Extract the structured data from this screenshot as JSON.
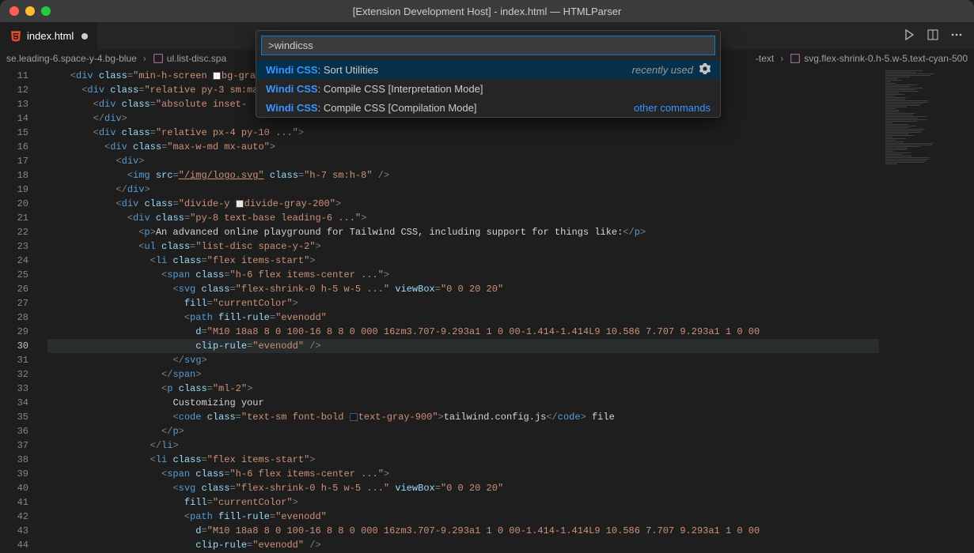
{
  "window": {
    "title": "[Extension Development Host] - index.html — HTMLParser"
  },
  "tab": {
    "filename": "index.html"
  },
  "breadcrumb": {
    "segments": [
      "se.leading-6.space-y-4.bg-blue",
      "ul.list-disc.spa",
      "-text",
      "svg.flex-shrink-0.h-5.w-5.text-cyan-500"
    ]
  },
  "palette": {
    "input_value": ">windicss",
    "items": [
      {
        "prefix": "Windi CSS",
        "suffix": ": Sort Utilities",
        "hint": "recently used",
        "hint_style": "gray",
        "gear": true
      },
      {
        "prefix": "Windi CSS",
        "suffix": ": Compile CSS [Interpretation Mode]",
        "hint": "",
        "gear": false
      },
      {
        "prefix": "Windi CSS",
        "suffix": ": Compile CSS [Compilation Mode]",
        "hint": "other commands",
        "hint_style": "blue",
        "gear": false
      }
    ]
  },
  "editor": {
    "line_start": 11,
    "line_end": 44,
    "active_line": 30,
    "lines": [
      {
        "n": 11,
        "indent": 4,
        "tokens": [
          [
            "punc",
            "<"
          ],
          [
            "tag",
            "div"
          ],
          [
            "txt",
            " "
          ],
          [
            "attr",
            "class"
          ],
          [
            "punc",
            "="
          ],
          [
            "str",
            "\"min-h-screen "
          ],
          [
            "swatch",
            "gray50"
          ],
          [
            "str",
            "bg-gray-"
          ]
        ]
      },
      {
        "n": 12,
        "indent": 6,
        "tokens": [
          [
            "punc",
            "<"
          ],
          [
            "tag",
            "div"
          ],
          [
            "txt",
            " "
          ],
          [
            "attr",
            "class"
          ],
          [
            "punc",
            "="
          ],
          [
            "str",
            "\"relative py-3 sm:ma"
          ]
        ]
      },
      {
        "n": 13,
        "indent": 8,
        "tokens": [
          [
            "punc",
            "<"
          ],
          [
            "tag",
            "div"
          ],
          [
            "txt",
            " "
          ],
          [
            "attr",
            "class"
          ],
          [
            "punc",
            "="
          ],
          [
            "str",
            "\"absolute inset-"
          ]
        ]
      },
      {
        "n": 14,
        "indent": 8,
        "tokens": [
          [
            "punc",
            "</"
          ],
          [
            "tag",
            "div"
          ],
          [
            "punc",
            ">"
          ]
        ]
      },
      {
        "n": 15,
        "indent": 8,
        "tokens": [
          [
            "punc",
            "<"
          ],
          [
            "tag",
            "div"
          ],
          [
            "txt",
            " "
          ],
          [
            "attr",
            "class"
          ],
          [
            "punc",
            "="
          ],
          [
            "str",
            "\"relative px-4 py-10 ...\""
          ],
          [
            "punc",
            ">"
          ]
        ]
      },
      {
        "n": 16,
        "indent": 10,
        "tokens": [
          [
            "punc",
            "<"
          ],
          [
            "tag",
            "div"
          ],
          [
            "txt",
            " "
          ],
          [
            "attr",
            "class"
          ],
          [
            "punc",
            "="
          ],
          [
            "str",
            "\"max-w-md mx-auto\""
          ],
          [
            "punc",
            ">"
          ]
        ]
      },
      {
        "n": 17,
        "indent": 12,
        "tokens": [
          [
            "punc",
            "<"
          ],
          [
            "tag",
            "div"
          ],
          [
            "punc",
            ">"
          ]
        ]
      },
      {
        "n": 18,
        "indent": 14,
        "tokens": [
          [
            "punc",
            "<"
          ],
          [
            "tag",
            "img"
          ],
          [
            "txt",
            " "
          ],
          [
            "attr",
            "src"
          ],
          [
            "punc",
            "="
          ],
          [
            "strlink",
            "\"/img/logo.svg\""
          ],
          [
            "txt",
            " "
          ],
          [
            "attr",
            "class"
          ],
          [
            "punc",
            "="
          ],
          [
            "str",
            "\"h-7 sm:h-8\""
          ],
          [
            "txt",
            " "
          ],
          [
            "punc",
            "/>"
          ]
        ]
      },
      {
        "n": 19,
        "indent": 12,
        "tokens": [
          [
            "punc",
            "</"
          ],
          [
            "tag",
            "div"
          ],
          [
            "punc",
            ">"
          ]
        ]
      },
      {
        "n": 20,
        "indent": 12,
        "tokens": [
          [
            "punc",
            "<"
          ],
          [
            "tag",
            "div"
          ],
          [
            "txt",
            " "
          ],
          [
            "attr",
            "class"
          ],
          [
            "punc",
            "="
          ],
          [
            "str",
            "\"divide-y "
          ],
          [
            "swatch",
            "gray200"
          ],
          [
            "str",
            "divide-gray-200\""
          ],
          [
            "punc",
            ">"
          ]
        ]
      },
      {
        "n": 21,
        "indent": 14,
        "tokens": [
          [
            "punc",
            "<"
          ],
          [
            "tag",
            "div"
          ],
          [
            "txt",
            " "
          ],
          [
            "attr",
            "class"
          ],
          [
            "punc",
            "="
          ],
          [
            "str",
            "\"py-8 text-base leading-6 ...\""
          ],
          [
            "punc",
            ">"
          ]
        ]
      },
      {
        "n": 22,
        "indent": 16,
        "tokens": [
          [
            "punc",
            "<"
          ],
          [
            "tag",
            "p"
          ],
          [
            "punc",
            ">"
          ],
          [
            "txt",
            "An advanced online playground for Tailwind CSS, including support for things like:"
          ],
          [
            "punc",
            "</"
          ],
          [
            "tag",
            "p"
          ],
          [
            "punc",
            ">"
          ]
        ]
      },
      {
        "n": 23,
        "indent": 16,
        "tokens": [
          [
            "punc",
            "<"
          ],
          [
            "tag",
            "ul"
          ],
          [
            "txt",
            " "
          ],
          [
            "attr",
            "class"
          ],
          [
            "punc",
            "="
          ],
          [
            "str",
            "\"list-disc space-y-2\""
          ],
          [
            "punc",
            ">"
          ]
        ]
      },
      {
        "n": 24,
        "indent": 18,
        "tokens": [
          [
            "punc",
            "<"
          ],
          [
            "tag",
            "li"
          ],
          [
            "txt",
            " "
          ],
          [
            "attr",
            "class"
          ],
          [
            "punc",
            "="
          ],
          [
            "str",
            "\"flex items-start\""
          ],
          [
            "punc",
            ">"
          ]
        ]
      },
      {
        "n": 25,
        "indent": 20,
        "tokens": [
          [
            "punc",
            "<"
          ],
          [
            "tag",
            "span"
          ],
          [
            "txt",
            " "
          ],
          [
            "attr",
            "class"
          ],
          [
            "punc",
            "="
          ],
          [
            "str",
            "\"h-6 flex items-center ...\""
          ],
          [
            "punc",
            ">"
          ]
        ]
      },
      {
        "n": 26,
        "indent": 22,
        "tokens": [
          [
            "punc",
            "<"
          ],
          [
            "tag",
            "svg"
          ],
          [
            "txt",
            " "
          ],
          [
            "attr",
            "class"
          ],
          [
            "punc",
            "="
          ],
          [
            "str",
            "\"flex-shrink-0 h-5 w-5 ...\""
          ],
          [
            "txt",
            " "
          ],
          [
            "attr",
            "viewBox"
          ],
          [
            "punc",
            "="
          ],
          [
            "str",
            "\"0 0 20 20\""
          ]
        ]
      },
      {
        "n": 27,
        "indent": 24,
        "tokens": [
          [
            "attr",
            "fill"
          ],
          [
            "punc",
            "="
          ],
          [
            "str",
            "\"currentColor\""
          ],
          [
            "punc",
            ">"
          ]
        ]
      },
      {
        "n": 28,
        "indent": 24,
        "tokens": [
          [
            "punc",
            "<"
          ],
          [
            "tag",
            "path"
          ],
          [
            "txt",
            " "
          ],
          [
            "attr",
            "fill-rule"
          ],
          [
            "punc",
            "="
          ],
          [
            "str",
            "\"evenodd\""
          ]
        ]
      },
      {
        "n": 29,
        "indent": 26,
        "tokens": [
          [
            "attr",
            "d"
          ],
          [
            "punc",
            "="
          ],
          [
            "str",
            "\"M10 18a8 8 0 100-16 8 8 0 000 16zm3.707-9.293a1 1 0 00-1.414-1.414L9 10.586 7.707 9.293a1 1 0 00"
          ]
        ]
      },
      {
        "n": 30,
        "indent": 26,
        "tokens": [
          [
            "attr",
            "clip-rule"
          ],
          [
            "punc",
            "="
          ],
          [
            "str",
            "\"evenodd\""
          ],
          [
            "txt",
            " "
          ],
          [
            "punc",
            "/>"
          ]
        ]
      },
      {
        "n": 31,
        "indent": 22,
        "tokens": [
          [
            "punc",
            "</"
          ],
          [
            "tag",
            "svg"
          ],
          [
            "punc",
            ">"
          ]
        ]
      },
      {
        "n": 32,
        "indent": 20,
        "tokens": [
          [
            "punc",
            "</"
          ],
          [
            "tag",
            "span"
          ],
          [
            "punc",
            ">"
          ]
        ]
      },
      {
        "n": 33,
        "indent": 20,
        "tokens": [
          [
            "punc",
            "<"
          ],
          [
            "tag",
            "p"
          ],
          [
            "txt",
            " "
          ],
          [
            "attr",
            "class"
          ],
          [
            "punc",
            "="
          ],
          [
            "str",
            "\"ml-2\""
          ],
          [
            "punc",
            ">"
          ]
        ]
      },
      {
        "n": 34,
        "indent": 22,
        "tokens": [
          [
            "txt",
            "Customizing your"
          ]
        ]
      },
      {
        "n": 35,
        "indent": 22,
        "tokens": [
          [
            "punc",
            "<"
          ],
          [
            "tag",
            "code"
          ],
          [
            "txt",
            " "
          ],
          [
            "attr",
            "class"
          ],
          [
            "punc",
            "="
          ],
          [
            "str",
            "\"text-sm font-bold "
          ],
          [
            "swatch",
            "gray900"
          ],
          [
            "str",
            "text-gray-900\""
          ],
          [
            "punc",
            ">"
          ],
          [
            "txt",
            "tailwind.config.js"
          ],
          [
            "punc",
            "</"
          ],
          [
            "tag",
            "code"
          ],
          [
            "punc",
            ">"
          ],
          [
            "txt",
            " file"
          ]
        ]
      },
      {
        "n": 36,
        "indent": 20,
        "tokens": [
          [
            "punc",
            "</"
          ],
          [
            "tag",
            "p"
          ],
          [
            "punc",
            ">"
          ]
        ]
      },
      {
        "n": 37,
        "indent": 18,
        "tokens": [
          [
            "punc",
            "</"
          ],
          [
            "tag",
            "li"
          ],
          [
            "punc",
            ">"
          ]
        ]
      },
      {
        "n": 38,
        "indent": 18,
        "tokens": [
          [
            "punc",
            "<"
          ],
          [
            "tag",
            "li"
          ],
          [
            "txt",
            " "
          ],
          [
            "attr",
            "class"
          ],
          [
            "punc",
            "="
          ],
          [
            "str",
            "\"flex items-start\""
          ],
          [
            "punc",
            ">"
          ]
        ]
      },
      {
        "n": 39,
        "indent": 20,
        "tokens": [
          [
            "punc",
            "<"
          ],
          [
            "tag",
            "span"
          ],
          [
            "txt",
            " "
          ],
          [
            "attr",
            "class"
          ],
          [
            "punc",
            "="
          ],
          [
            "str",
            "\"h-6 flex items-center ...\""
          ],
          [
            "punc",
            ">"
          ]
        ]
      },
      {
        "n": 40,
        "indent": 22,
        "tokens": [
          [
            "punc",
            "<"
          ],
          [
            "tag",
            "svg"
          ],
          [
            "txt",
            " "
          ],
          [
            "attr",
            "class"
          ],
          [
            "punc",
            "="
          ],
          [
            "str",
            "\"flex-shrink-0 h-5 w-5 ...\""
          ],
          [
            "txt",
            " "
          ],
          [
            "attr",
            "viewBox"
          ],
          [
            "punc",
            "="
          ],
          [
            "str",
            "\"0 0 20 20\""
          ]
        ]
      },
      {
        "n": 41,
        "indent": 24,
        "tokens": [
          [
            "attr",
            "fill"
          ],
          [
            "punc",
            "="
          ],
          [
            "str",
            "\"currentColor\""
          ],
          [
            "punc",
            ">"
          ]
        ]
      },
      {
        "n": 42,
        "indent": 24,
        "tokens": [
          [
            "punc",
            "<"
          ],
          [
            "tag",
            "path"
          ],
          [
            "txt",
            " "
          ],
          [
            "attr",
            "fill-rule"
          ],
          [
            "punc",
            "="
          ],
          [
            "str",
            "\"evenodd\""
          ]
        ]
      },
      {
        "n": 43,
        "indent": 26,
        "tokens": [
          [
            "attr",
            "d"
          ],
          [
            "punc",
            "="
          ],
          [
            "str",
            "\"M10 18a8 8 0 100-16 8 8 0 000 16zm3.707-9.293a1 1 0 00-1.414-1.414L9 10.586 7.707 9.293a1 1 0 00"
          ]
        ]
      },
      {
        "n": 44,
        "indent": 26,
        "tokens": [
          [
            "attr",
            "clip-rule"
          ],
          [
            "punc",
            "="
          ],
          [
            "str",
            "\"evenodd\""
          ],
          [
            "txt",
            " "
          ],
          [
            "punc",
            "/>"
          ]
        ]
      }
    ]
  }
}
